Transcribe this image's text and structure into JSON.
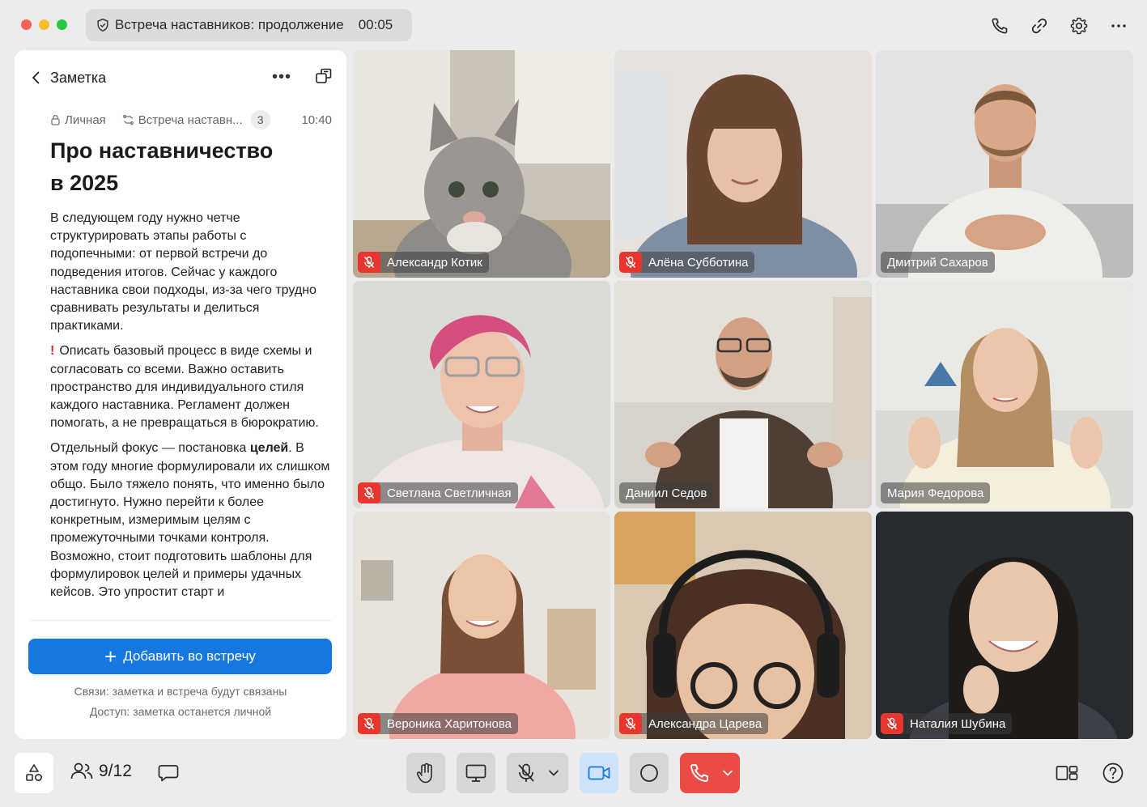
{
  "titlebar": {
    "meeting_title": "Встреча наставников: продолжение",
    "timer": "00:05"
  },
  "top_icons": [
    "phone-icon",
    "link-icon",
    "gear-icon",
    "more-icon"
  ],
  "note": {
    "header": "Заметка",
    "privacy": "Личная",
    "meeting_ref": "Встреча наставн...",
    "count": "3",
    "time": "10:40",
    "title_line1": "Про наставничество",
    "title_line2": "в 2025",
    "paragraph1": "В следующем году нужно четче структурировать этапы работы с подопечными: от первой встречи до подведения итогов. Сейчас у каждого наставника свои подходы, из-за чего трудно сравнивать результаты и делиться практиками.",
    "paragraph2_mark": "!",
    "paragraph2": "Описать базовый процесс в виде схемы и согласовать со всеми. Важно оставить пространство для индивидуального стиля каждого наставника. Регламент должен помогать, а не превращаться в бюрократию.",
    "paragraph3_pre": "Отдельный фокус — постановка ",
    "paragraph3_bold": "целей",
    "paragraph3_post": ". В этом году многие формулировали их слишком общо. Было тяжело понять, что именно было достигнуто. Нужно перейти к более конкретным, измеримым целям с промежуточными точками контроля. Возможно, стоит подготовить шаблоны для формулировок целей и примеры удачных кейсов. Это упростит старт и",
    "add_button": "Добавить во встречу",
    "link_note": "Связи: заметка и встреча будут связаны",
    "access_note": "Доступ: заметка останется личной"
  },
  "participants": [
    {
      "name": "Александр Котик",
      "muted": true,
      "active": false
    },
    {
      "name": "Алёна Субботина",
      "muted": true,
      "active": false
    },
    {
      "name": "Дмитрий Сахаров",
      "muted": false,
      "active": false
    },
    {
      "name": "Светлана Светличная",
      "muted": true,
      "active": false
    },
    {
      "name": "Даниил Седов",
      "muted": false,
      "active": true
    },
    {
      "name": "Мария Федорова",
      "muted": false,
      "active": true
    },
    {
      "name": "Вероника Харитонова",
      "muted": true,
      "active": false
    },
    {
      "name": "Александра Царева",
      "muted": true,
      "active": false
    },
    {
      "name": "Наталия Шубина",
      "muted": true,
      "active": false
    }
  ],
  "toolbar": {
    "participants_count": "9/12"
  },
  "colors": {
    "accent": "#1478e0",
    "active_border": "#1e88ef",
    "mute_red": "#e8362e",
    "end_call": "#ea4b44"
  }
}
